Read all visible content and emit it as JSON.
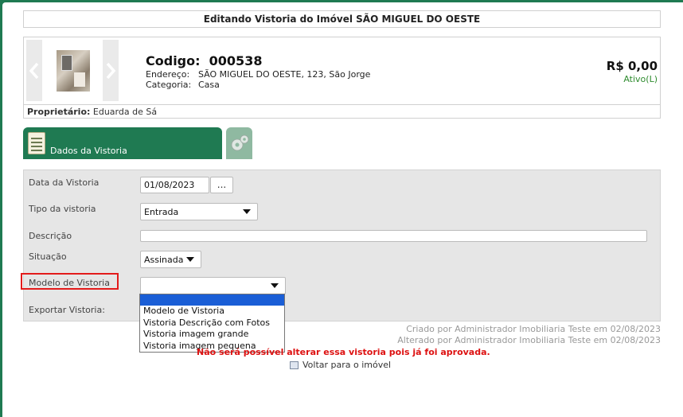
{
  "modal": {
    "title": "Editando Vistoria do Imóvel SÃO MIGUEL DO OESTE"
  },
  "property": {
    "codigo_label": "Codigo:",
    "codigo_value": "000538",
    "endereco_label": "Endereço:",
    "endereco_value": "SÃO MIGUEL DO OESTE, 123, São Jorge",
    "categoria_label": "Categoria:",
    "categoria_value": "Casa",
    "price": "R$ 0,00",
    "status": "Ativo(L)",
    "owner_label": "Proprietário:",
    "owner_value": "Eduarda de Sá"
  },
  "tabs": {
    "active_label": "Dados da Vistoria",
    "settings_icon": "gear-icon",
    "notepad_icon": "notepad-icon"
  },
  "form": {
    "data_label": "Data da Vistoria",
    "data_value": "01/08/2023",
    "data_button": "...",
    "tipo_label": "Tipo da vistoria",
    "tipo_value": "Entrada",
    "descricao_label": "Descrição",
    "descricao_value": "",
    "situacao_label": "Situação",
    "situacao_value": "Assinada",
    "modelo_label": "Modelo de Vistoria",
    "modelo_value": "",
    "exportar_label": "Exportar Vistoria:"
  },
  "modelo_dropdown": {
    "options": [
      "",
      "Modelo de Vistoria",
      "Vistoria Descrição com Fotos",
      "Vistoria imagem grande",
      "Vistoria imagem pequena"
    ]
  },
  "footer": {
    "created": "Criado por Administrador Imobiliaria Teste em 02/08/2023",
    "updated": "Alterado por Administrador Imobiliaria Teste em 02/08/2023",
    "warning": "Não será possível alterar essa vistoria pois já foi aprovada.",
    "back_link": "Voltar para o imóvel"
  },
  "colors": {
    "brand_green": "#1f7a52",
    "highlight_red": "#e31b1b",
    "status_green": "#2e8b2e",
    "warning_red": "#dd1111"
  }
}
